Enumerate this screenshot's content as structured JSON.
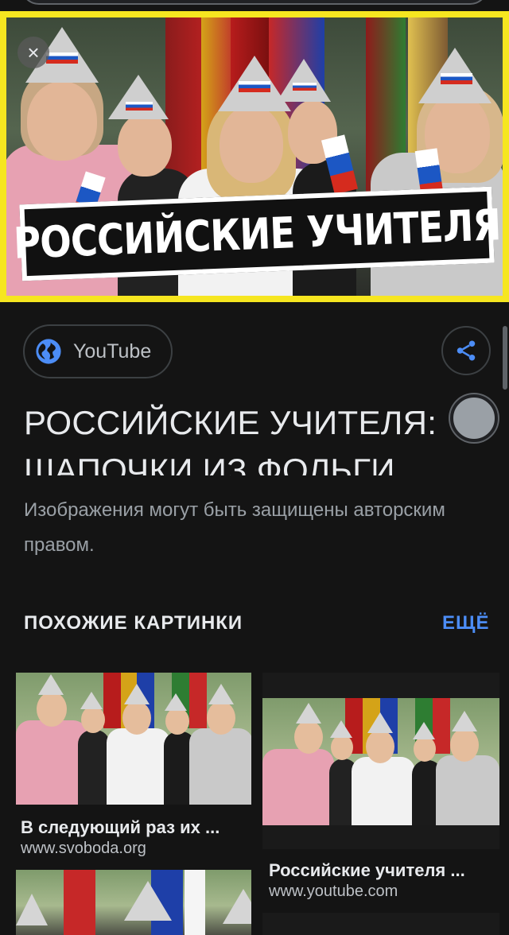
{
  "hero": {
    "banner_text": "РОССИЙСКИЕ УЧИТЕЛЯ",
    "border_color": "#f6e620"
  },
  "close_icon_glyph": "×",
  "source": {
    "icon": "globe-icon",
    "label": "YouTube",
    "share_icon": "share-icon"
  },
  "title": "РОССИЙСКИЕ УЧИТЕЛЯ: ШАПОЧКИ ИЗ ФОЛЬГИ",
  "copyright_notice": "Изображения могут быть защищены авторским правом.",
  "related": {
    "heading": "ПОХОЖИЕ КАРТИНКИ",
    "more_label": "ЕЩЁ",
    "accent": "#4c8df6",
    "items": [
      {
        "title": "В следующий раз их ...",
        "source": "www.svoboda.org"
      },
      {
        "title": "Российские учителя ...",
        "source": "www.youtube.com"
      }
    ]
  }
}
